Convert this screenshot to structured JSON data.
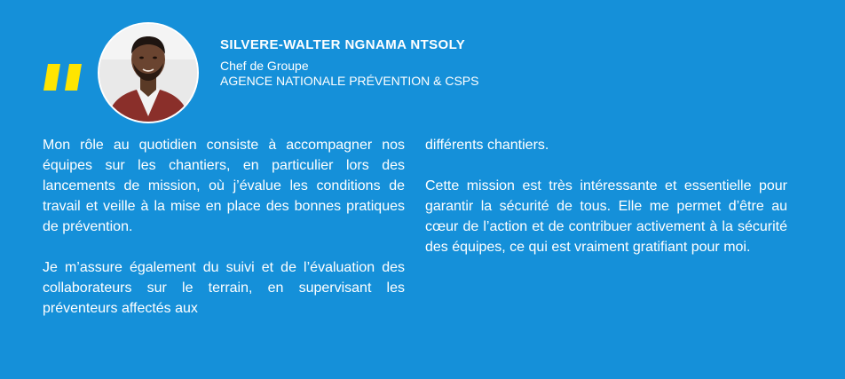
{
  "person": {
    "name": "SILVERE-WALTER NGNAMA NTSOLY",
    "role": "Chef de Groupe",
    "organization": "AGENCE NATIONALE PRÉVENTION & CSPS"
  },
  "quote_icon": "double-quote-icon",
  "avatar_icon": "portrait-photo",
  "colors": {
    "background": "#1590d9",
    "accent": "#ffe500",
    "text": "#ffffff"
  },
  "testimonial": {
    "left_column": {
      "paragraph_1": "Mon rôle au quotidien consiste à accompagner nos équipes sur les chantiers, en particulier lors des lancements de mission, où j’évalue les conditions de travail et veille à la mise en place des bonnes pratiques de prévention.",
      "paragraph_2": "Je m’assure également du suivi et de l’évaluation des collaborateurs sur le terrain, en supervisant les préventeurs affectés aux"
    },
    "right_column": {
      "paragraph_1": "différents chantiers.",
      "paragraph_2": "Cette mission est très intéressante et essentielle pour garantir la sécurité de tous. Elle me permet d’être au cœur de l’action et de contribuer activement à la sécurité des équipes, ce qui est vraiment gratifiant pour moi."
    }
  }
}
